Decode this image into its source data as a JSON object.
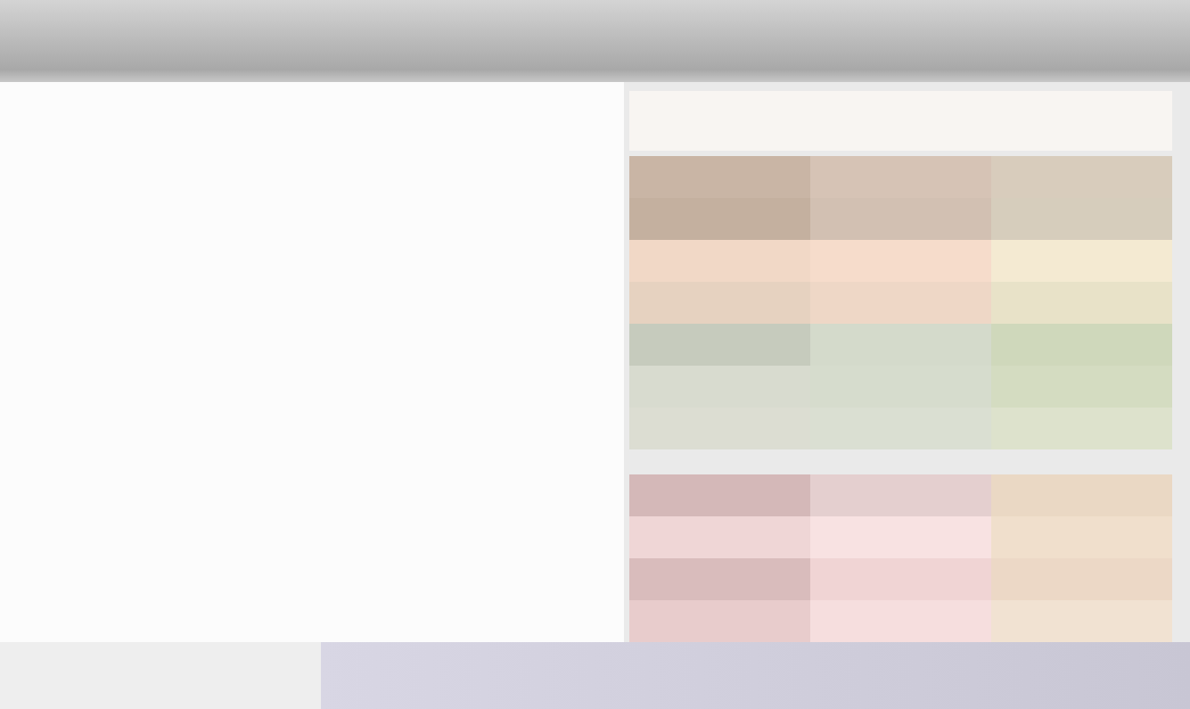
{
  "table": {
    "rows": [
      {
        "cells": [
          {
            "color": "#c9b5a5"
          },
          {
            "color": "#d6c3b5"
          },
          {
            "color": "#d8ccbc"
          }
        ]
      },
      {
        "cells": [
          {
            "color": "#c4b09f"
          },
          {
            "color": "#d2c0b2"
          },
          {
            "color": "#d6cdbc"
          }
        ]
      },
      {
        "cells": [
          {
            "color": "#f1d8c6"
          },
          {
            "color": "#f6dccb"
          },
          {
            "color": "#f4ead2"
          }
        ]
      },
      {
        "cells": [
          {
            "color": "#e6d2c0"
          },
          {
            "color": "#eed7c6"
          },
          {
            "color": "#e8e2c8"
          }
        ]
      },
      {
        "cells": [
          {
            "color": "#c6cbbd"
          },
          {
            "color": "#d4dacb"
          },
          {
            "color": "#cfd8bb"
          }
        ]
      },
      {
        "cells": [
          {
            "color": "#d8dbcf"
          },
          {
            "color": "#d6dccd"
          },
          {
            "color": "#d4dcc1"
          }
        ]
      },
      {
        "cells": [
          {
            "color": "#dcddd2"
          },
          {
            "color": "#dadfd2"
          },
          {
            "color": "#dde2cc"
          }
        ]
      },
      {
        "cells": [
          {
            "color": "#d4b8b8"
          },
          {
            "color": "#e4cfcf"
          },
          {
            "color": "#ead8c4"
          }
        ]
      },
      {
        "cells": [
          {
            "color": "#efd6d6"
          },
          {
            "color": "#f8e2e2"
          },
          {
            "color": "#f0dfcc"
          }
        ]
      },
      {
        "cells": [
          {
            "color": "#d9bcbc"
          },
          {
            "color": "#f0d4d4"
          },
          {
            "color": "#ecd8c6"
          }
        ]
      },
      {
        "cells": [
          {
            "color": "#e8cccc"
          },
          {
            "color": "#f6dede"
          },
          {
            "color": "#f1e2d2"
          }
        ]
      }
    ]
  }
}
